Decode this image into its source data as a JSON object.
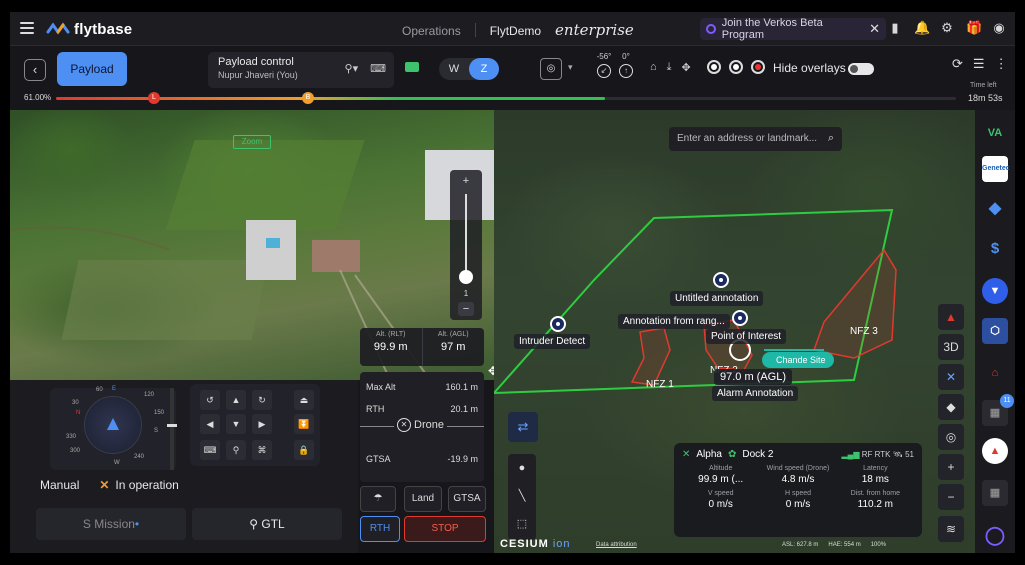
{
  "header": {
    "logo_text": "flytbase",
    "operations": "Operations",
    "workspace": "FlytDemo",
    "edition": "enterprise",
    "beta_banner": "Join the Verkos Beta Program"
  },
  "controls": {
    "payload_label": "Payload",
    "payload_control_title": "Payload control",
    "payload_control_user": "Nupur Jhaveri (You)",
    "w_label": "W",
    "z_label": "Z",
    "gimbal_pitch": "-56°",
    "gimbal_yaw": "0°",
    "hide_overlays": "Hide overlays",
    "time_left_label": "Time left"
  },
  "progress": {
    "battery_label": "61.00%",
    "fraction": 0.61,
    "time_left": "18m 53s",
    "marker_l": "L",
    "marker_b": "B"
  },
  "camera": {
    "zoom_tag": "Zoom",
    "zoom_value": "1",
    "zoom_level": 0.08
  },
  "map": {
    "search_placeholder": "Enter an address or landmark...",
    "annotations": {
      "untitled": "Untitled annotation",
      "from_range": "Annotation from rang...",
      "poi": "Point of Interest",
      "intruder": "Intruder Detect",
      "alarm": "Alarm Annotation",
      "chande": "Chande Site",
      "agl": "97.0 m (AGL)"
    },
    "nfz": [
      "NFZ 1",
      "NFZ 2",
      "NFZ 3"
    ],
    "btn_3d": "3D",
    "cesium": "CESIUM",
    "ion": "ion",
    "attribution": "Data attribution",
    "footer": {
      "asl": "ASL: 627.8 m",
      "hae": "HAE: 554 m",
      "battery": "100%"
    }
  },
  "telemetry": {
    "drone": "Alpha",
    "dock": "Dock 2",
    "link": "RF RTK",
    "sats": "51",
    "fields": [
      {
        "label": "Altitude",
        "value": "99.9 m (..."
      },
      {
        "label": "Wind speed (Drone)",
        "value": "4.8 m/s"
      },
      {
        "label": "Latency",
        "value": "18 ms"
      },
      {
        "label": "V speed",
        "value": "0 m/s"
      },
      {
        "label": "H speed",
        "value": "0 m/s"
      },
      {
        "label": "Dist. from home",
        "value": "110.2 m"
      }
    ]
  },
  "compass": {
    "labels": {
      "n60": "60",
      "e": "E",
      "d120": "120",
      "w": "W",
      "d240": "240",
      "d300": "300",
      "d330": "330",
      "d30": "30",
      "s150": "150",
      "s": "S",
      "n": "N"
    }
  },
  "mode": {
    "manual": "Manual",
    "status": "In operation",
    "mission": "Mission",
    "gtl": "GTL"
  },
  "flight": {
    "alt_rlt_label": "Alt. (RLT)",
    "alt_rlt_value": "99.9 m",
    "alt_agl_label": "Alt. (AGL)",
    "alt_agl_value": "97 m",
    "max_alt_label": "Max Alt",
    "max_alt_value": "160.1 m",
    "rth_label": "RTH",
    "rth_value": "20.1 m",
    "drone_label": "Drone",
    "gtsa_label": "GTSA",
    "gtsa_value": "-19.9 m",
    "land": "Land",
    "gtsa_btn": "GTSA",
    "rth_btn": "RTH",
    "stop_btn": "STOP"
  },
  "integrations": {
    "genetec": "Genetec",
    "badge": "11"
  },
  "colors": {
    "accent": "#4d8ff2",
    "geofence": "#2ecc40",
    "nfz": "#e03a2e",
    "stop": "#e03a2e"
  }
}
